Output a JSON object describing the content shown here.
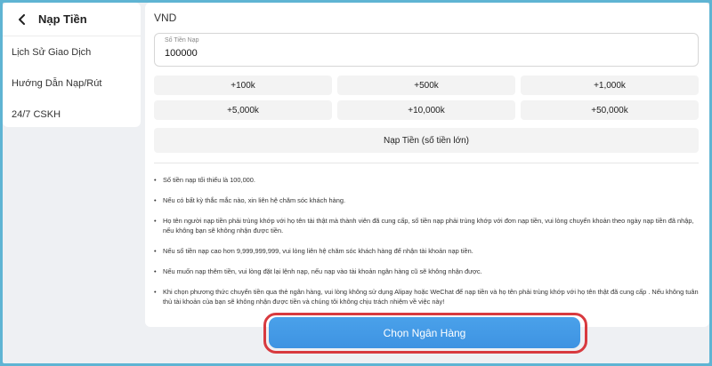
{
  "sidebar": {
    "title": "Nạp Tiền",
    "items": [
      {
        "label": "Lịch Sử Giao Dịch"
      },
      {
        "label": "Hướng Dẫn Nạp/Rút"
      },
      {
        "label": "24/7 CSKH"
      }
    ]
  },
  "main": {
    "currency": "VND",
    "amount": {
      "label": "Số Tiền Nạp",
      "value": "100000"
    },
    "quick_amounts": [
      "+100k",
      "+500k",
      "+1,000k",
      "+5,000k",
      "+10,000k",
      "+50,000k"
    ],
    "large_amount_label": "Nạp Tiền (số tiền lớn)",
    "notes": [
      "Số tiền nạp tối thiểu là 100,000.",
      "Nếu có bất kỳ thắc mắc nào, xin liên hệ chăm sóc khách hàng.",
      "Họ tên người nạp tiền phải trùng khớp với họ tên tài thật mà thành viên đã cung cấp, số tiền nạp phải trùng khớp với đơn nạp tiền, vui lòng chuyển khoản theo ngày nạp tiền đã nhập, nếu không bạn sẽ không nhận được tiền.",
      "Nếu số tiền nạp cao hơn 9,999,999,999, vui lòng liên hệ chăm sóc khách hàng để nhận tài khoản nạp tiền.",
      "Nếu muốn nạp thêm tiền, vui lòng đặt lại lệnh nạp, nếu nạp vào tài khoản ngân hàng cũ sẽ không nhận được.",
      "Khi chọn phương thức chuyển tiền qua thẻ ngân hàng, vui lòng không sử dụng Alipay hoặc WeChat để nạp tiền và họ tên phải trùng khớp với họ tên thật đã cung cấp . Nếu không tuân thủ tài khoản của bạn sẽ không nhận được tiền và chúng tôi không chịu trách nhiệm về việc này!"
    ],
    "cta_label": "Chọn Ngân Hàng"
  },
  "colors": {
    "primary": "#4aa1ea",
    "highlight_ring": "#d83a3f",
    "backdrop": "#5fb4d3"
  }
}
